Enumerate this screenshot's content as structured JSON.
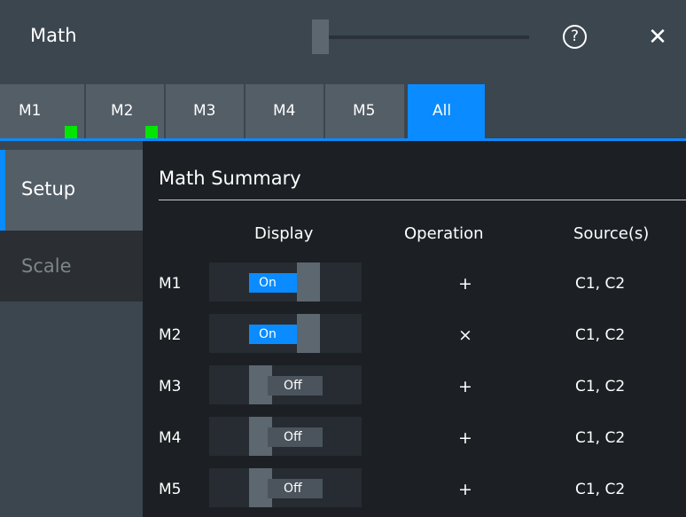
{
  "window": {
    "title": "Math",
    "help_glyph": "?",
    "close_glyph": "✕"
  },
  "tabs": [
    {
      "label": "M1",
      "indicator": true
    },
    {
      "label": "M2",
      "indicator": true
    },
    {
      "label": "M3",
      "indicator": false
    },
    {
      "label": "M4",
      "indicator": false
    },
    {
      "label": "M5",
      "indicator": false
    },
    {
      "label": "All",
      "active": true
    }
  ],
  "sidebar": {
    "setup": "Setup",
    "scale": "Scale"
  },
  "summary": {
    "title": "Math Summary",
    "columns": {
      "display": "Display",
      "operation": "Operation",
      "sources": "Source(s)"
    },
    "rows": [
      {
        "name": "M1",
        "display": "On",
        "operation": "+",
        "sources": "C1, C2"
      },
      {
        "name": "M2",
        "display": "On",
        "operation": "×",
        "sources": "C1, C2"
      },
      {
        "name": "M3",
        "display": "Off",
        "operation": "+",
        "sources": "C1, C2"
      },
      {
        "name": "M4",
        "display": "Off",
        "operation": "+",
        "sources": "C1, C2"
      },
      {
        "name": "M5",
        "display": "Off",
        "operation": "+",
        "sources": "C1, C2"
      }
    ]
  },
  "colors": {
    "accent": "#0a8bff",
    "indicator": "#00e600"
  }
}
